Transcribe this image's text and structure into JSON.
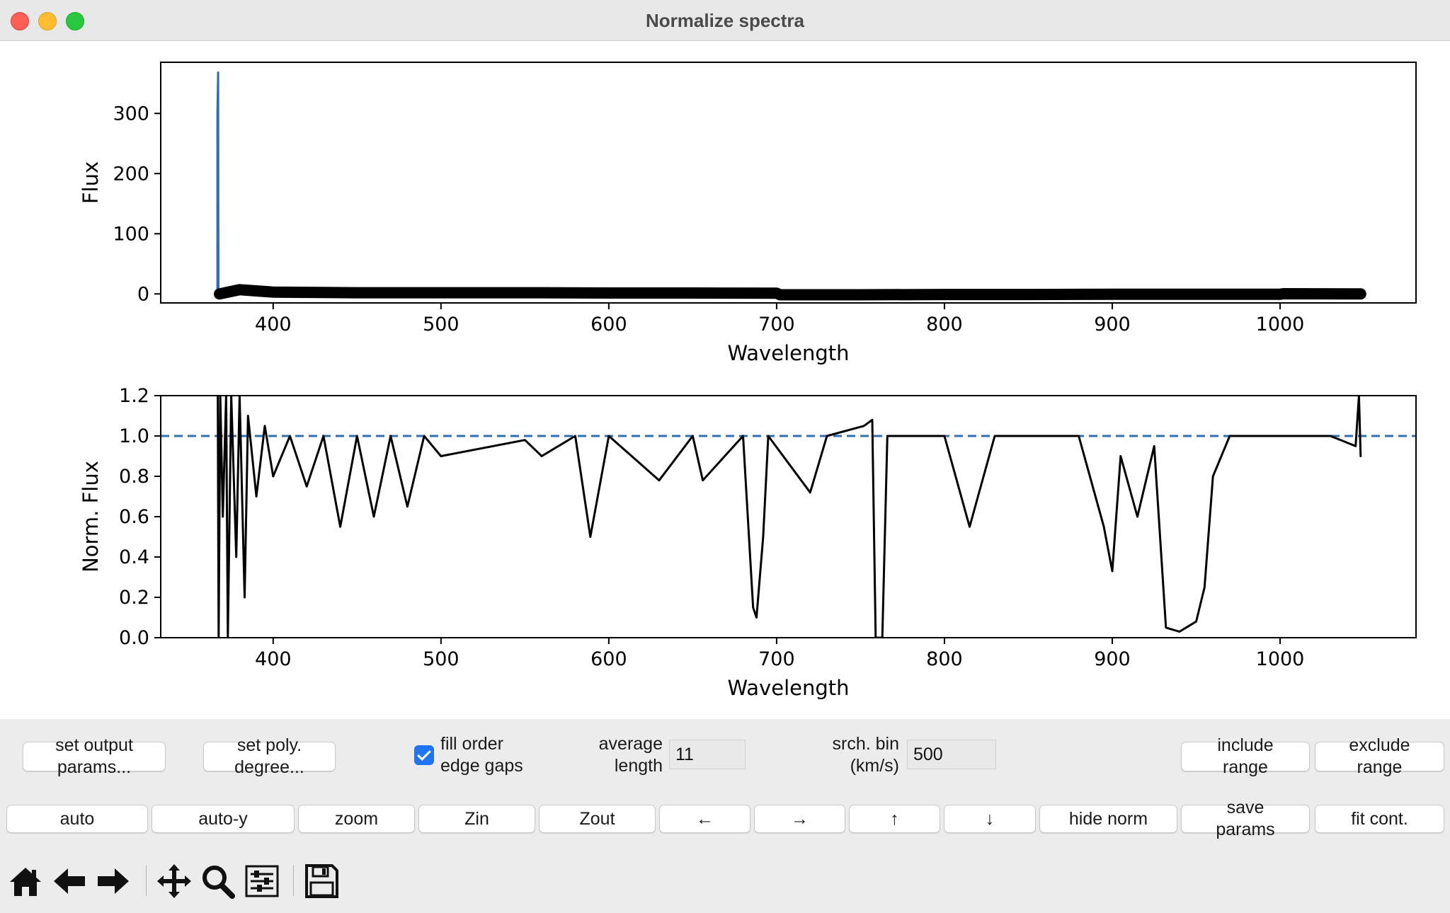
{
  "window": {
    "title": "Normalize spectra"
  },
  "chart_data": [
    {
      "type": "line",
      "title": "",
      "xlabel": "Wavelength",
      "ylabel": "Flux",
      "xlim": [
        333,
        1081
      ],
      "ylim": [
        -15,
        385
      ],
      "xticks": [
        400,
        500,
        600,
        700,
        800,
        900,
        1000
      ],
      "yticks": [
        0,
        100,
        200,
        300
      ],
      "grid": false,
      "series": [
        {
          "name": "",
          "color": "#2e6fad",
          "points": [
            [
              366.8,
              0
            ],
            [
              366.8,
              300
            ],
            [
              367.2,
              368
            ],
            [
              367.4,
              5
            ],
            [
              368,
              2
            ]
          ]
        },
        {
          "name": "",
          "color": "#000000",
          "points": [
            [
              368,
              0
            ],
            [
              380,
              7
            ],
            [
              400,
              3
            ],
            [
              450,
              2
            ],
            [
              500,
              2
            ],
            [
              550,
              2
            ],
            [
              600,
              1.5
            ],
            [
              650,
              1.5
            ],
            [
              700,
              1.2
            ],
            [
              702,
              -1.5
            ],
            [
              750,
              -1.5
            ],
            [
              800,
              -1
            ],
            [
              850,
              -1
            ],
            [
              900,
              -0.5
            ],
            [
              950,
              -0.5
            ],
            [
              1000,
              -0.5
            ],
            [
              1002,
              0.3
            ],
            [
              1048,
              0
            ]
          ]
        }
      ]
    },
    {
      "type": "line",
      "title": "",
      "xlabel": "Wavelength",
      "ylabel": "Norm. Flux",
      "xlim": [
        333,
        1081
      ],
      "ylim": [
        0,
        1.2
      ],
      "xticks": [
        400,
        500,
        600,
        700,
        800,
        900,
        1000
      ],
      "yticks": [
        0.0,
        0.2,
        0.4,
        0.6,
        0.8,
        1.0,
        1.2
      ],
      "grid": false,
      "reference_line": {
        "y": 1.0,
        "style": "dashed",
        "color": "#2e6fad"
      },
      "series": [
        {
          "name": "",
          "color": "#000000",
          "points": [
            [
              367,
              1.2
            ],
            [
              367.5,
              0
            ],
            [
              368.5,
              1.2
            ],
            [
              370,
              0.6
            ],
            [
              372,
              1.2
            ],
            [
              373,
              0
            ],
            [
              375,
              1.2
            ],
            [
              378,
              0.4
            ],
            [
              380,
              1.2
            ],
            [
              383,
              0.2
            ],
            [
              385,
              1.1
            ],
            [
              390,
              0.7
            ],
            [
              395,
              1.05
            ],
            [
              400,
              0.8
            ],
            [
              410,
              1.0
            ],
            [
              420,
              0.75
            ],
            [
              430,
              1.0
            ],
            [
              440,
              0.55
            ],
            [
              450,
              1.0
            ],
            [
              460,
              0.6
            ],
            [
              470,
              1.0
            ],
            [
              480,
              0.65
            ],
            [
              490,
              1.0
            ],
            [
              500,
              0.9
            ],
            [
              550,
              0.98
            ],
            [
              560,
              0.9
            ],
            [
              580,
              1.0
            ],
            [
              589,
              0.5
            ],
            [
              600,
              1.0
            ],
            [
              630,
              0.78
            ],
            [
              650,
              1.0
            ],
            [
              656,
              0.78
            ],
            [
              680,
              1.0
            ],
            [
              686,
              0.15
            ],
            [
              688,
              0.1
            ],
            [
              692,
              0.5
            ],
            [
              695,
              1.0
            ],
            [
              720,
              0.72
            ],
            [
              730,
              1.0
            ],
            [
              752,
              1.05
            ],
            [
              757,
              1.08
            ],
            [
              759,
              0.0
            ],
            [
              763,
              0.0
            ],
            [
              766,
              1.0
            ],
            [
              800,
              1.0
            ],
            [
              815,
              0.55
            ],
            [
              820,
              0.7
            ],
            [
              830,
              1.0
            ],
            [
              880,
              1.0
            ],
            [
              895,
              0.55
            ],
            [
              900,
              0.33
            ],
            [
              905,
              0.9
            ],
            [
              915,
              0.6
            ],
            [
              925,
              0.95
            ],
            [
              932,
              0.05
            ],
            [
              940,
              0.03
            ],
            [
              950,
              0.08
            ],
            [
              955,
              0.25
            ],
            [
              960,
              0.8
            ],
            [
              970,
              1.0
            ],
            [
              1000,
              1.0
            ],
            [
              1030,
              1.0
            ],
            [
              1045,
              0.95
            ],
            [
              1047,
              1.2
            ],
            [
              1048,
              0.9
            ]
          ]
        }
      ]
    }
  ],
  "controls": {
    "set_output_params": "set output\nparams...",
    "set_poly_degree": "set poly.\ndegree...",
    "fill_order_edge_gaps": {
      "label": "fill order\nedge gaps",
      "checked": true
    },
    "average_length": {
      "label": "average\nlength",
      "value": "11"
    },
    "srch_bin": {
      "label": "srch. bin\n(km/s)",
      "value": "500"
    },
    "include_range": "include\nrange",
    "exclude_range": "exclude\nrange",
    "row2": {
      "auto": "auto",
      "auto_y": "auto-y",
      "zoom": "zoom",
      "zin": "Zin",
      "zout": "Zout",
      "left": "←",
      "right": "→",
      "up": "↑",
      "down": "↓",
      "hide_norm": "hide norm",
      "save_params": "save\nparams",
      "fit_cont": "fit cont."
    }
  },
  "toolbar": {
    "icons": [
      "home-icon",
      "back-arrow-icon",
      "forward-arrow-icon",
      "pan-icon",
      "zoom-magnifier-icon",
      "configure-subplots-icon",
      "save-icon"
    ]
  }
}
